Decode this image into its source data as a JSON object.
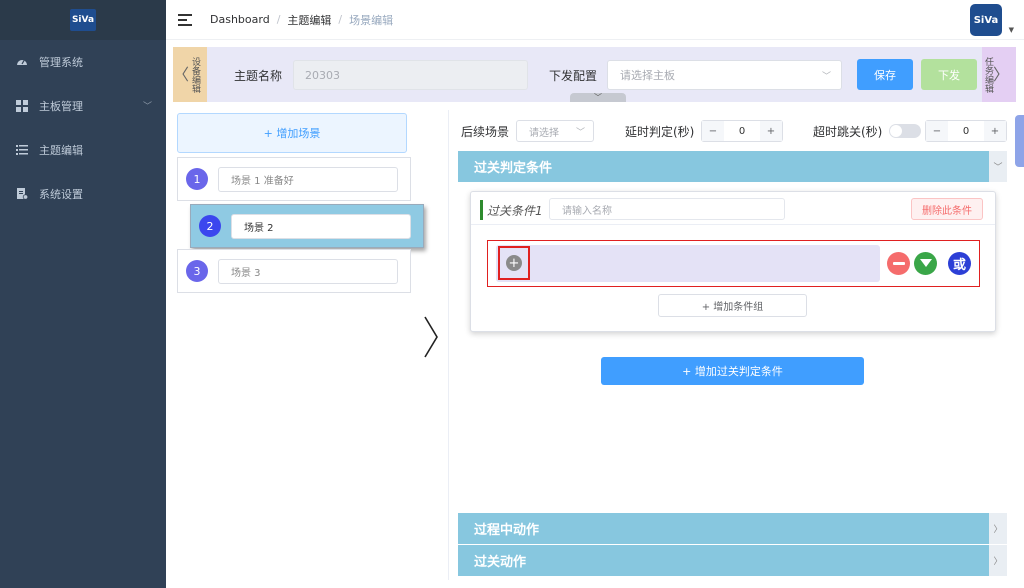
{
  "brand": {
    "logo_text": "SiVa",
    "avatar_text": "SiVa"
  },
  "sidebar": {
    "items": [
      {
        "label": "管理系统",
        "icon": "dashboard-icon"
      },
      {
        "label": "主板管理",
        "icon": "grid-icon",
        "expandable": true
      },
      {
        "label": "主题编辑",
        "icon": "list-icon"
      },
      {
        "label": "系统设置",
        "icon": "settings-doc-icon"
      }
    ]
  },
  "header": {
    "breadcrumb": [
      "Dashboard",
      "主题编辑",
      "场景编辑"
    ]
  },
  "config": {
    "left_tab": "设备编辑",
    "right_tab": "任务编辑",
    "theme_name_label": "主题名称",
    "theme_name_value": "20303",
    "dispatch_label": "下发配置",
    "dispatch_placeholder": "请选择主板",
    "save_label": "保存",
    "issue_label": "下发"
  },
  "scenes": {
    "add_label": "+ 增加场景",
    "items": [
      {
        "num": "1",
        "name": "场景 1 准备好"
      },
      {
        "num": "2",
        "name": "场景 2",
        "active": true
      },
      {
        "num": "3",
        "name": "场景 3"
      }
    ]
  },
  "editor": {
    "next_scene_label": "后续场景",
    "next_scene_placeholder": "请选择",
    "delay_label": "延时判定(秒)",
    "delay_value": "0",
    "timeout_label": "超时跳关(秒)",
    "timeout_value": "0",
    "timeout_enabled": false,
    "pass_conditions_title": "过关判定条件",
    "condition": {
      "title": "过关条件1",
      "name_placeholder": "请输入名称",
      "delete_label": "删除此条件",
      "or_label": "或",
      "add_group_label": "+ 增加条件组"
    },
    "add_pass_condition_label": "+ 增加过关判定条件",
    "in_process_title": "过程中动作",
    "pass_action_title": "过关动作"
  }
}
